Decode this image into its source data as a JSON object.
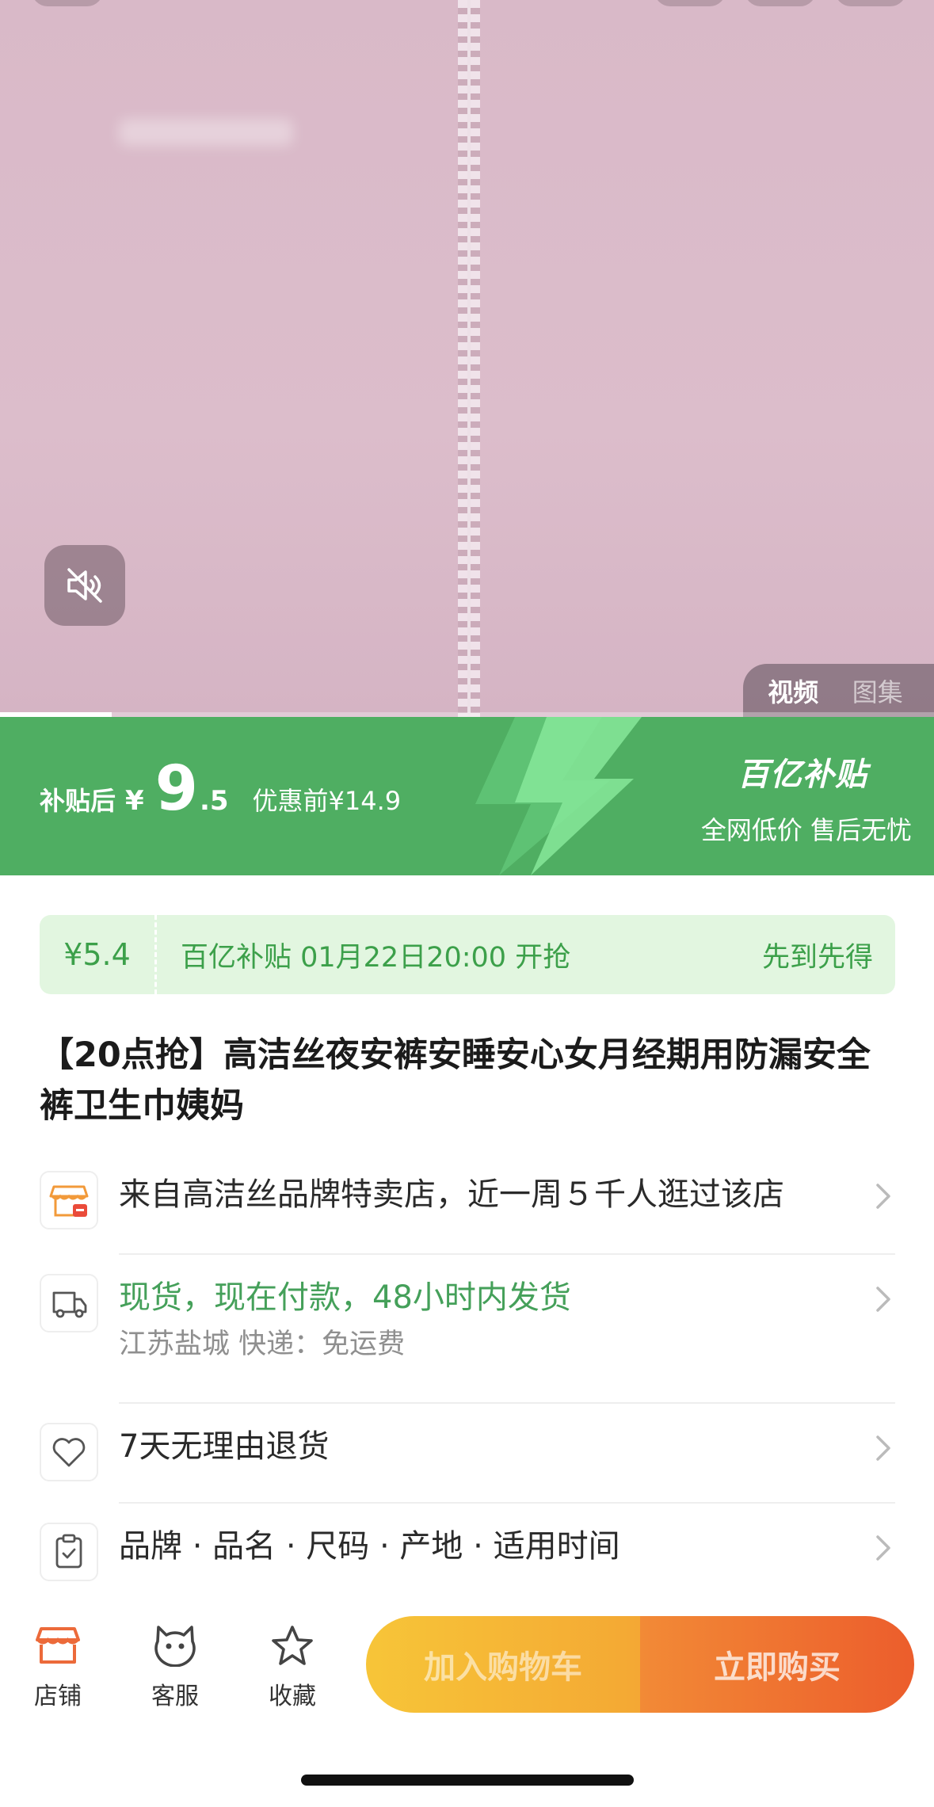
{
  "media": {
    "tabs": [
      "视频",
      "图集"
    ],
    "active_tab_index": 0,
    "video_progress": 0.12
  },
  "subsidy_banner": {
    "after_label": "补贴后",
    "currency": "¥",
    "price_int": "9",
    "price_dec": ".5",
    "original_price": "优惠前¥14.9",
    "brand": "百亿补贴",
    "slogan": "全网低价 售后无忧",
    "colors": {
      "background": "#4fae62",
      "bolt": "#7be38f"
    }
  },
  "coupon": {
    "amount": "¥5.4",
    "description": "百亿补贴 01月22日20:00 开抢",
    "tail": "先到先得",
    "colors": {
      "background": "#e2f6e0",
      "text": "#3ca04a"
    }
  },
  "product": {
    "title": "【20点抢】高洁丝夜安裤安睡安心女月经期用防漏安全裤卫生巾姨妈"
  },
  "info_rows": {
    "store": {
      "icon": "store-icon",
      "text": "来自高洁丝品牌特卖店，近一周５千人逛过该店"
    },
    "shipping": {
      "icon": "delivery-truck-icon",
      "text": "现货，现在付款，48小时内发货",
      "sub": "江苏盐城  快递：免运费"
    },
    "returns": {
      "icon": "heart-icon",
      "text": "7天无理由退货"
    },
    "params": {
      "icon": "clipboard-check-icon",
      "text": "品牌 · 品名 · 尺码 · 产地 · 适用时间"
    }
  },
  "bottom_bar": {
    "store_label": "店铺",
    "service_label": "客服",
    "favorite_label": "收藏",
    "add_to_cart": "加入购物车",
    "buy_now": "立即购买",
    "colors": {
      "accent": "#ec5d2c",
      "cart": "#f7c538"
    }
  }
}
